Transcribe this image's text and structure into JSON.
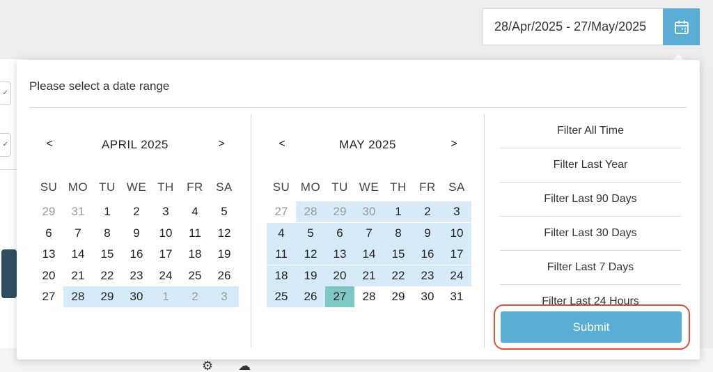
{
  "date_range": {
    "value": "28/Apr/2025 - 27/May/2025",
    "icon": "calendar-icon"
  },
  "popup": {
    "title": "Please select a date range",
    "weekdays": [
      "SU",
      "MO",
      "TU",
      "WE",
      "TH",
      "FR",
      "SA"
    ],
    "calendars": [
      {
        "title": "APRIL 2025",
        "prev": "<",
        "next": ">",
        "weeks": [
          [
            "29",
            "31",
            "1",
            "2",
            "3",
            "4",
            "5"
          ],
          [
            "6",
            "7",
            "8",
            "9",
            "10",
            "11",
            "12"
          ],
          [
            "13",
            "14",
            "15",
            "16",
            "17",
            "18",
            "19"
          ],
          [
            "20",
            "21",
            "22",
            "23",
            "24",
            "25",
            "26"
          ],
          [
            "27",
            "28",
            "29",
            "30",
            "1",
            "2",
            "3"
          ]
        ],
        "off": [
          [
            0,
            0
          ],
          [
            0,
            1
          ],
          [
            4,
            4
          ],
          [
            4,
            5
          ],
          [
            4,
            6
          ]
        ],
        "in_range": [
          [
            4,
            1
          ],
          [
            4,
            2
          ],
          [
            4,
            3
          ],
          [
            4,
            4
          ],
          [
            4,
            5
          ],
          [
            4,
            6
          ]
        ],
        "selected": []
      },
      {
        "title": "MAY 2025",
        "prev": "<",
        "next": ">",
        "weeks": [
          [
            "27",
            "28",
            "29",
            "30",
            "1",
            "2",
            "3"
          ],
          [
            "4",
            "5",
            "6",
            "7",
            "8",
            "9",
            "10"
          ],
          [
            "11",
            "12",
            "13",
            "14",
            "15",
            "16",
            "17"
          ],
          [
            "18",
            "19",
            "20",
            "21",
            "22",
            "23",
            "24"
          ],
          [
            "25",
            "26",
            "27",
            "28",
            "29",
            "30",
            "31"
          ]
        ],
        "off": [
          [
            0,
            0
          ],
          [
            0,
            1
          ],
          [
            0,
            2
          ],
          [
            0,
            3
          ]
        ],
        "in_range": [
          [
            0,
            1
          ],
          [
            0,
            2
          ],
          [
            0,
            3
          ],
          [
            0,
            4
          ],
          [
            0,
            5
          ],
          [
            0,
            6
          ],
          [
            1,
            0
          ],
          [
            1,
            1
          ],
          [
            1,
            2
          ],
          [
            1,
            3
          ],
          [
            1,
            4
          ],
          [
            1,
            5
          ],
          [
            1,
            6
          ],
          [
            2,
            0
          ],
          [
            2,
            1
          ],
          [
            2,
            2
          ],
          [
            2,
            3
          ],
          [
            2,
            4
          ],
          [
            2,
            5
          ],
          [
            2,
            6
          ],
          [
            3,
            0
          ],
          [
            3,
            1
          ],
          [
            3,
            2
          ],
          [
            3,
            3
          ],
          [
            3,
            4
          ],
          [
            3,
            5
          ],
          [
            3,
            6
          ],
          [
            4,
            0
          ],
          [
            4,
            1
          ]
        ],
        "selected": [
          [
            4,
            2
          ]
        ]
      }
    ],
    "filters": [
      "Filter All Time",
      "Filter Last Year",
      "Filter Last 90 Days",
      "Filter Last 30 Days",
      "Filter Last 7 Days",
      "Filter Last 24 Hours"
    ],
    "submit_label": "Submit"
  },
  "colors": {
    "accent": "#5aaed3",
    "range_fill": "#d6ebf7",
    "selected_fill": "#7fc7c4",
    "highlight_border": "#d9503a"
  }
}
